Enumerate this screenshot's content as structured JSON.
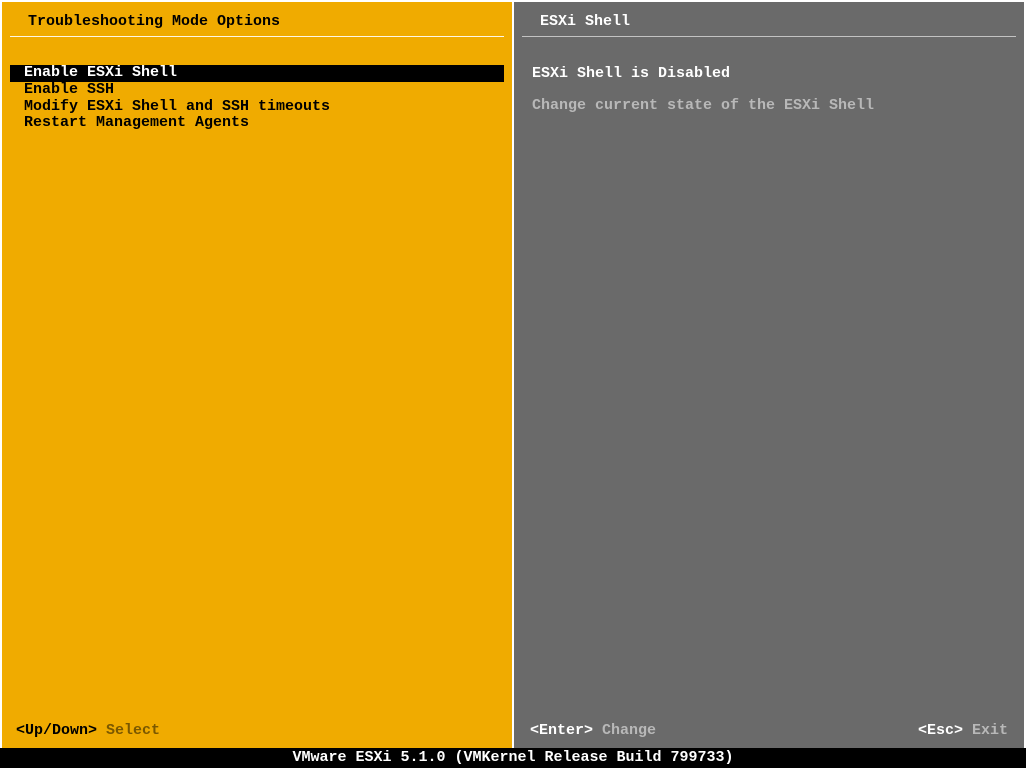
{
  "left": {
    "title": "Troubleshooting Mode Options",
    "menu": [
      {
        "label": "Enable ESXi Shell",
        "selected": true
      },
      {
        "label": "Enable SSH",
        "selected": false
      },
      {
        "label": "Modify ESXi Shell and SSH timeouts",
        "selected": false
      },
      {
        "label": "Restart Management Agents",
        "selected": false
      }
    ],
    "footer": {
      "key": "<Up/Down>",
      "label": "Select"
    }
  },
  "right": {
    "title": "ESXi Shell",
    "status": "ESXi Shell is Disabled",
    "description": "Change current state of the ESXi Shell",
    "footer_left": {
      "key": "<Enter>",
      "label": "Change"
    },
    "footer_right": {
      "key": "<Esc>",
      "label": "Exit"
    }
  },
  "status_bar": "VMware ESXi 5.1.0 (VMKernel Release Build 799733)"
}
